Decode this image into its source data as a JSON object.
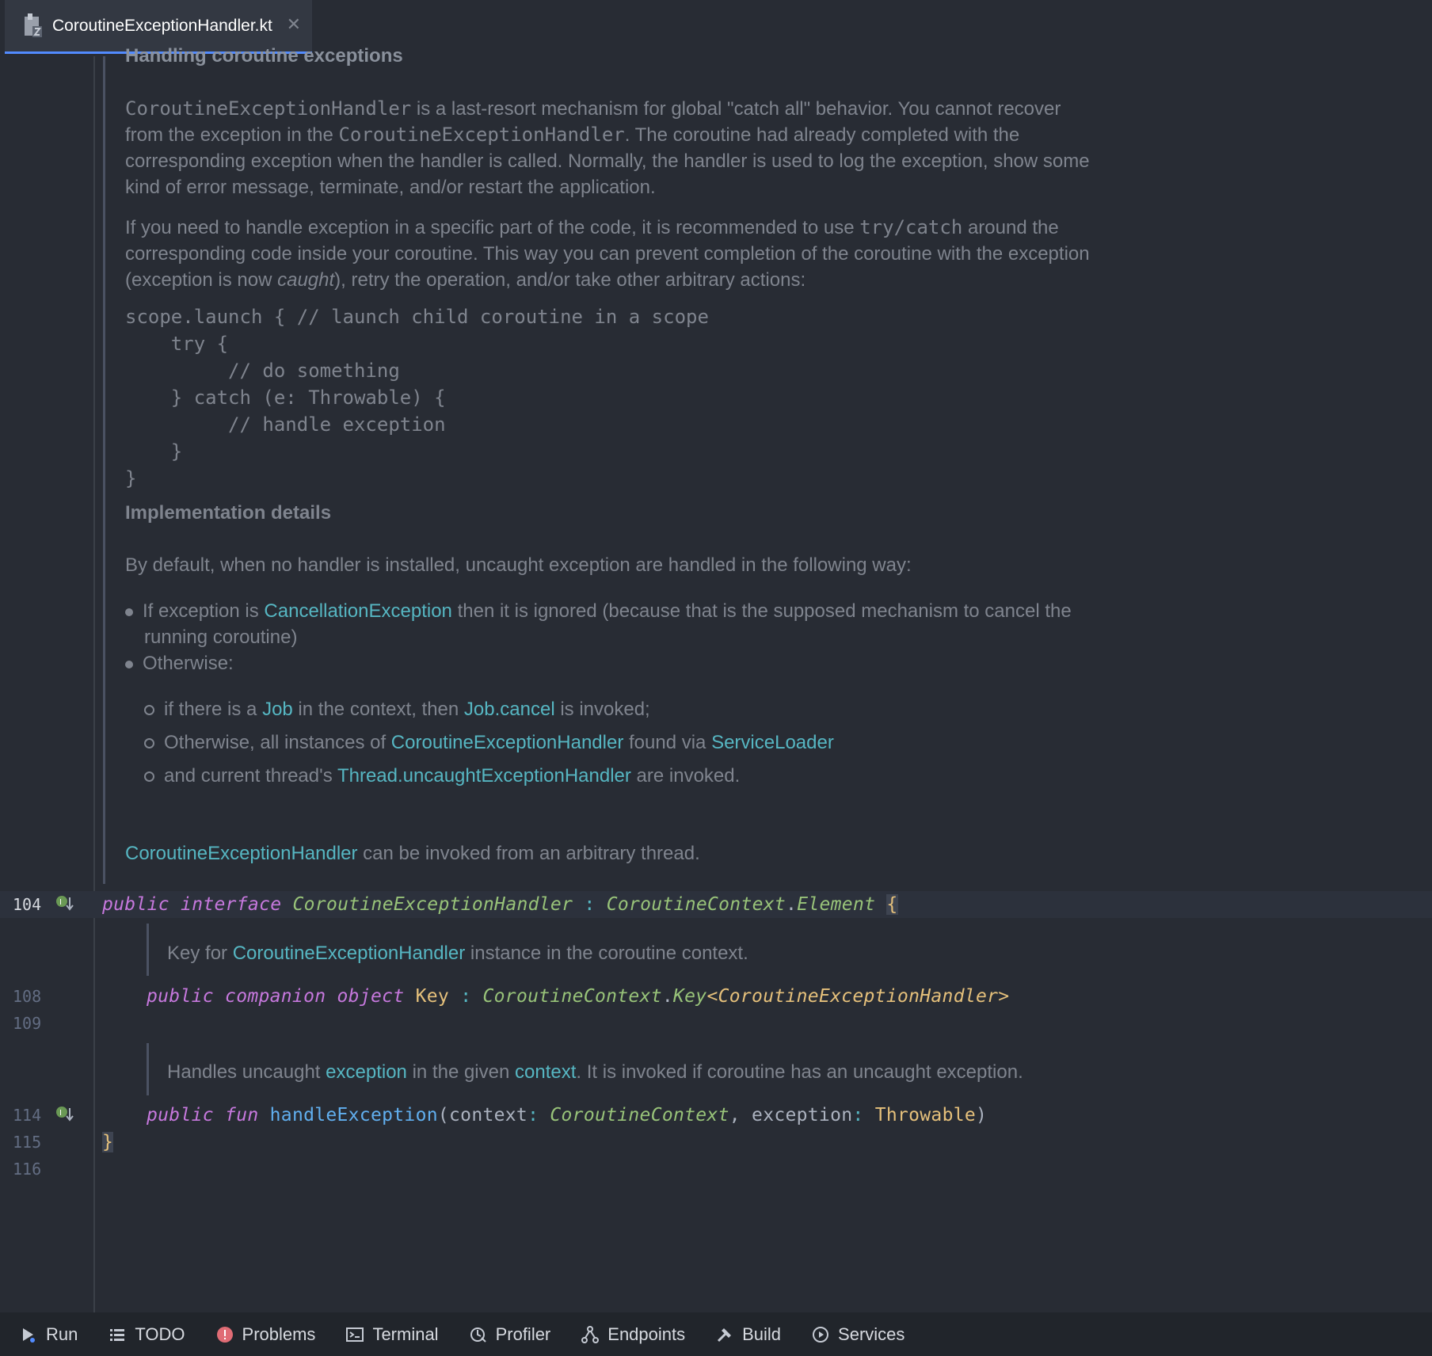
{
  "tab": {
    "title": "CoroutineExceptionHandler.kt"
  },
  "doc": {
    "heading_top": "Handling coroutine exceptions",
    "p1": {
      "code1": "CoroutineExceptionHandler",
      "t1": " is a last-resort mechanism for global \"catch all\" behavior. You cannot recover",
      "t2": "from the exception in the ",
      "code2": "CoroutineExceptionHandler",
      "t3": ". The coroutine had already completed with the",
      "t4": "corresponding exception when the handler is called. Normally, the handler is used to log the exception, show some",
      "t5": "kind of error message, terminate, and/or restart the application."
    },
    "p2": {
      "t1": "If you need to handle exception in a specific part of the code, it is recommended to use ",
      "code": "try/catch",
      "t2": " around the",
      "t3": "corresponding code inside your coroutine. This way you can prevent completion of the coroutine with the exception",
      "t4": "(exception is now ",
      "em": "caught",
      "t5": "), retry the operation, and/or take other arbitrary actions:"
    },
    "code_lines": [
      "scope.launch { // launch child coroutine in a scope",
      "    try {",
      "         // do something",
      "    } catch (e: Throwable) {",
      "         // handle exception",
      "    }",
      "}"
    ],
    "impl_heading": "Implementation details",
    "impl_intro": "By default, when no handler is installed, uncaught exception are handled in the following way:",
    "bullet1": {
      "t1": "If exception is ",
      "link": "CancellationException",
      "t2": " then it is ignored (because that is the supposed mechanism to cancel the",
      "t3": "running coroutine)"
    },
    "bullet2": "Otherwise:",
    "sub1": {
      "t1": "if there is a ",
      "link1": "Job",
      "t2": " in the context, then ",
      "link2": "Job.cancel",
      "t3": " is invoked;"
    },
    "sub2": {
      "t1": "Otherwise, all instances of ",
      "link1": "CoroutineExceptionHandler",
      "t2": " found via ",
      "link2": "ServiceLoader"
    },
    "sub3": {
      "t1": "and current thread's ",
      "link1": "Thread.uncaughtExceptionHandler",
      "t2": " are invoked."
    },
    "footer": {
      "link": "CoroutineExceptionHandler",
      "t1": " can be invoked from an arbitrary thread."
    }
  },
  "lines": {
    "l104": "104",
    "l108": "108",
    "l109": "109",
    "l114": "114",
    "l115": "115",
    "l116": "116"
  },
  "code": {
    "decl": {
      "kw1": "public",
      "kw2": "interface",
      "name": "CoroutineExceptionHandler",
      "colon": ":",
      "type1": "CoroutineContext",
      "dot": ".",
      "type2": "Element",
      "brace": "{"
    },
    "key_doc": {
      "t1": "Key for ",
      "link": "CoroutineExceptionHandler",
      "t2": " instance in the coroutine context."
    },
    "companion": {
      "kw1": "public",
      "kw2": "companion",
      "kw3": "object",
      "name": "Key",
      "colon": ":",
      "type1": "CoroutineContext",
      "dot": ".",
      "type2": "Key",
      "generic": "<CoroutineExceptionHandler>"
    },
    "handle_doc": {
      "t1": "Handles uncaught ",
      "link1": "exception",
      "t2": " in the given ",
      "link2": "context",
      "t3": ". It is invoked if coroutine has an uncaught exception."
    },
    "fun": {
      "kw1": "public",
      "kw2": "fun",
      "name": "handleException",
      "p1": "(context",
      "colon1": ":",
      "type1": "CoroutineContext",
      "comma": ",",
      "p2": "exception",
      "colon2": ":",
      "type2": "Throwable",
      "close": ")"
    },
    "close_brace": "}"
  },
  "toolbar": {
    "items": [
      {
        "label": "Run",
        "icon": "run-icon"
      },
      {
        "label": "TODO",
        "icon": "todo-icon"
      },
      {
        "label": "Problems",
        "icon": "problems-icon"
      },
      {
        "label": "Terminal",
        "icon": "terminal-icon"
      },
      {
        "label": "Profiler",
        "icon": "profiler-icon"
      },
      {
        "label": "Endpoints",
        "icon": "endpoints-icon"
      },
      {
        "label": "Build",
        "icon": "build-icon"
      },
      {
        "label": "Services",
        "icon": "services-icon"
      }
    ]
  },
  "colors": {
    "background": "#282c34",
    "keyword": "#c678dd",
    "type": "#98c379",
    "link": "#56b6c2",
    "function": "#61afef",
    "brace": "#e5c07b"
  }
}
